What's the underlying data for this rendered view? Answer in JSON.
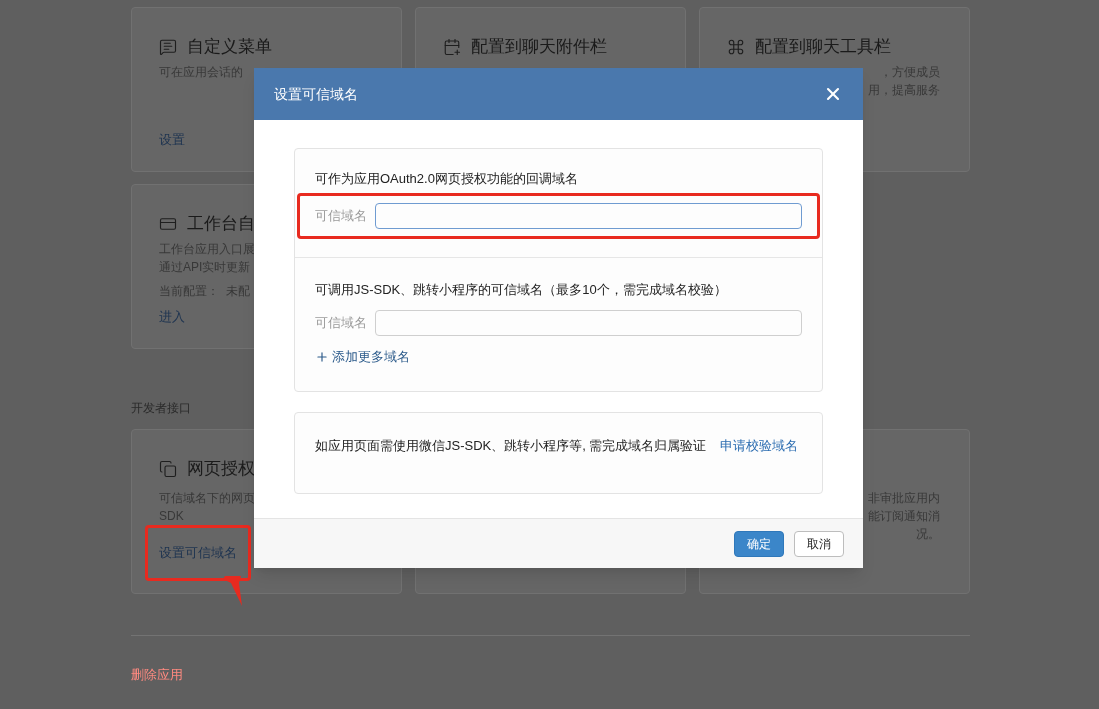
{
  "card_rows": [
    [
      {
        "title": "自定义菜单",
        "description": [
          "可在应用会话的"
        ],
        "link": "设置",
        "link_highlighted": false
      },
      {
        "title": "配置到聊天附件栏"
      },
      {
        "title": "配置到聊天工具栏",
        "description": [
          "，方便成员",
          "用，提高服务"
        ]
      }
    ],
    [
      {
        "title": "工作台自",
        "description": [
          "工作台应用入口展",
          "通过API实时更新"
        ],
        "note": "当前配置：  未配",
        "link": "进入",
        "link_highlighted": false
      }
    ]
  ],
  "developer_section": {
    "label": "开发者接口",
    "cards": [
      {
        "title": "网页授权",
        "description": [
          "可信域名下的网页",
          "SDK"
        ],
        "link": "设置可信域名",
        "link_highlighted": true
      },
      {
        "description": [
          "非审批应用内",
          "能订阅通知消",
          "况。"
        ]
      }
    ]
  },
  "delete_link": "删除应用",
  "dialog": {
    "title": "设置可信域名",
    "sections": [
      {
        "heading": "可作为应用OAuth2.0网页授权功能的回调域名",
        "fields": [
          {
            "label": "可信域名",
            "focused": true,
            "highlighted": true
          }
        ]
      },
      {
        "heading": "可调用JS-SDK、跳转小程序的可信域名（最多10个，需完成域名校验）",
        "fields": [
          {
            "label": "可信域名",
            "focused": false,
            "highlighted": false
          }
        ],
        "add_link": "添加更多域名"
      }
    ],
    "notice": {
      "text": "如应用页面需使用微信JS-SDK、跳转小程序等, 需完成域名归属验证",
      "link": "申请校验域名"
    },
    "buttons": [
      {
        "label": "确定",
        "primary": true
      },
      {
        "label": "取消",
        "primary": false
      }
    ]
  }
}
